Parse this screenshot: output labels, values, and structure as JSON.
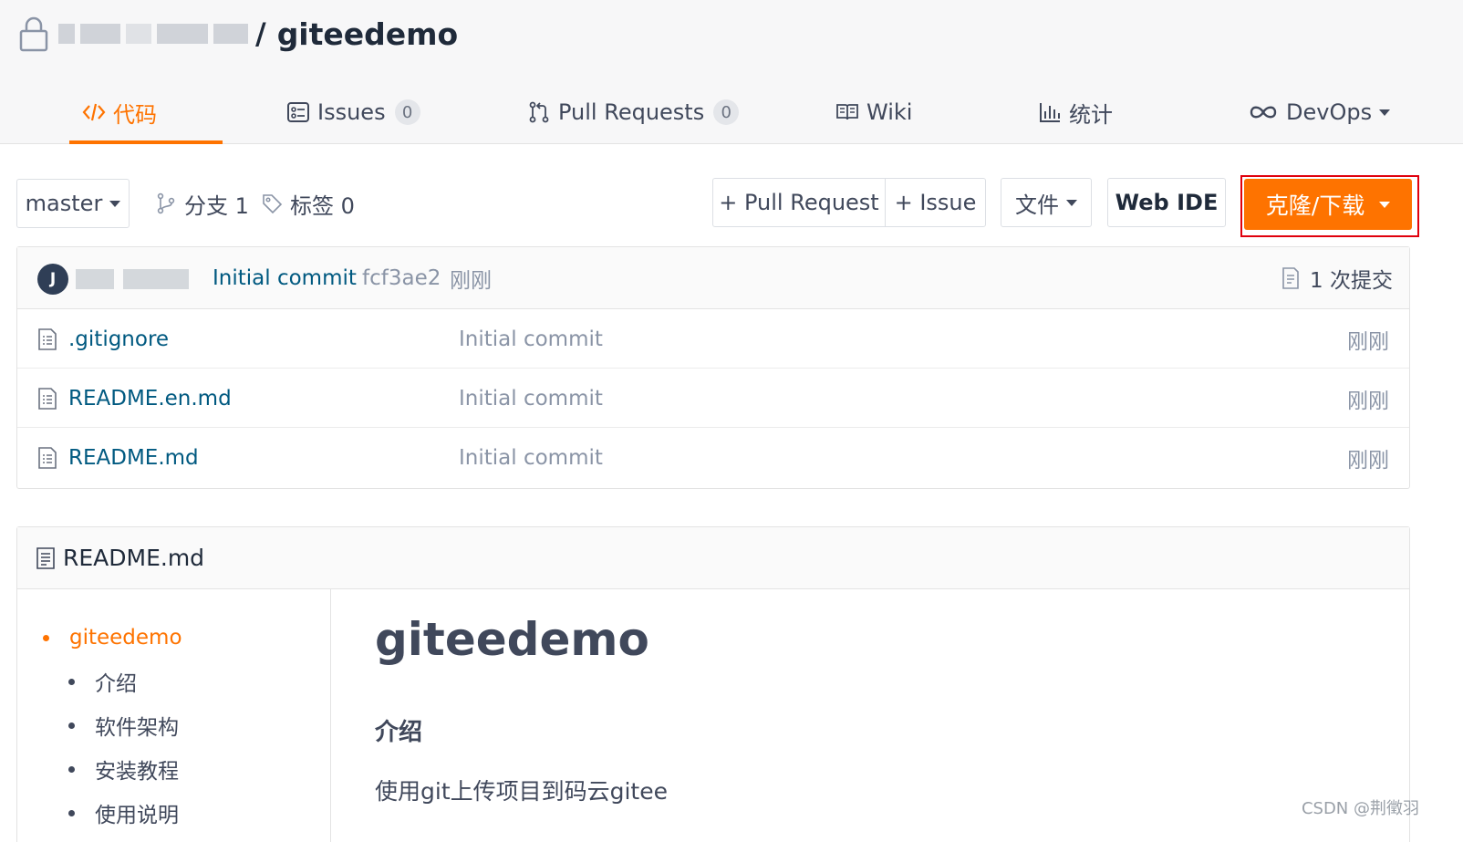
{
  "repo": {
    "separator": "/",
    "name": "giteedemo"
  },
  "tabs": [
    {
      "label": "代码",
      "icon": "code-icon",
      "active": true
    },
    {
      "label": "Issues",
      "icon": "issues-icon",
      "badge": "0"
    },
    {
      "label": "Pull Requests",
      "icon": "pull-request-icon",
      "badge": "0"
    },
    {
      "label": "Wiki",
      "icon": "wiki-book-icon"
    },
    {
      "label": "统计",
      "icon": "bar-chart-icon"
    },
    {
      "label": "DevOps",
      "icon": "infinity-icon",
      "dropdown": true
    }
  ],
  "toolbar": {
    "branch": "master",
    "branches": "分支 1",
    "tags": "标签 0",
    "new_pull_request": "+ Pull Request",
    "new_issue": "+ Issue",
    "file_menu": "文件",
    "web_ide": "Web IDE",
    "clone_download": "克隆/下载",
    "clone_highlight_color": "#e0000d",
    "accent_color": "#fe7300"
  },
  "latest_commit": {
    "avatar_initial": "J",
    "message": "Initial commit",
    "sha": "fcf3ae2",
    "time": "刚刚",
    "count_label": "1 次提交"
  },
  "files": [
    {
      "name": ".gitignore",
      "message": "Initial commit",
      "time": "刚刚"
    },
    {
      "name": "README.en.md",
      "message": "Initial commit",
      "time": "刚刚"
    },
    {
      "name": "README.md",
      "message": "Initial commit",
      "time": "刚刚"
    }
  ],
  "readme": {
    "filename": "README.md",
    "toc": [
      {
        "label": "giteedemo",
        "active": true
      },
      {
        "label": "介绍"
      },
      {
        "label": "软件架构"
      },
      {
        "label": "安装教程"
      },
      {
        "label": "使用说明"
      }
    ],
    "h1": "giteedemo",
    "h3": "介绍",
    "paragraph": "使用git上传项目到码云gitee"
  },
  "watermark": "CSDN @荆徵羽"
}
